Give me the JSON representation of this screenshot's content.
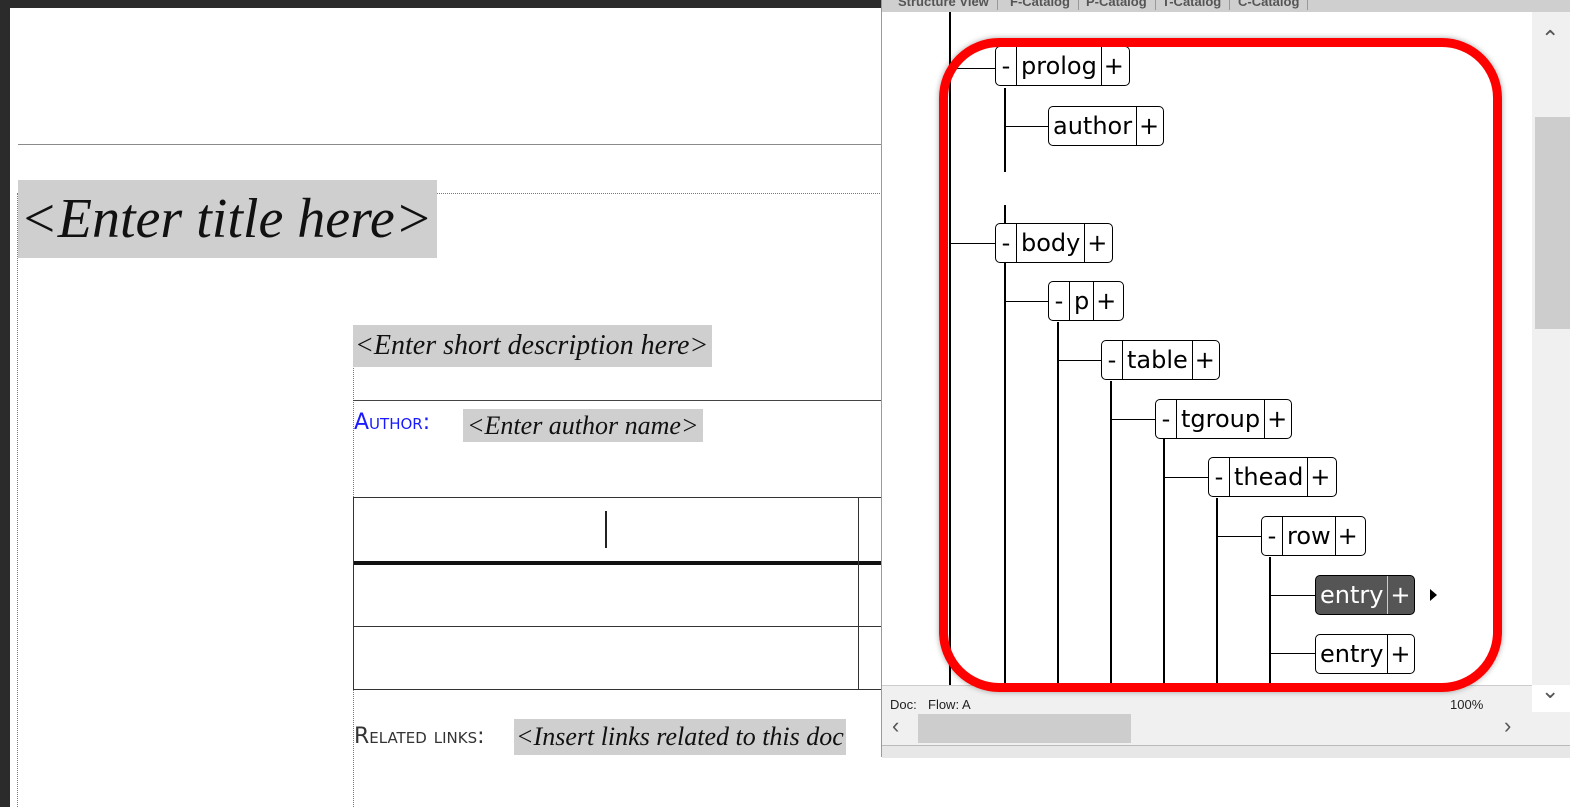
{
  "document": {
    "title_placeholder": "<Enter title here>",
    "shortdesc_placeholder": "<Enter short description here>",
    "author_label": "Author:",
    "author_placeholder": "<Enter author name>",
    "related_links_label": "Related links:",
    "related_links_placeholder": "<Insert links related to this doc"
  },
  "structure_view": {
    "tabs": [
      "Structure View",
      "F-Catalog",
      "P-Catalog",
      "T-Catalog",
      "C-Catalog"
    ],
    "nodes": [
      {
        "label": "prolog",
        "collapse": "-",
        "expand": "+"
      },
      {
        "label": "author",
        "collapse": "",
        "expand": "+"
      },
      {
        "label": "body",
        "collapse": "-",
        "expand": "+"
      },
      {
        "label": "p",
        "collapse": "-",
        "expand": "+"
      },
      {
        "label": "table",
        "collapse": "-",
        "expand": "+"
      },
      {
        "label": "tgroup",
        "collapse": "-",
        "expand": "+"
      },
      {
        "label": "thead",
        "collapse": "-",
        "expand": "+"
      },
      {
        "label": "row",
        "collapse": "-",
        "expand": "+"
      },
      {
        "label": "entry",
        "collapse": "",
        "expand": "+",
        "selected": true
      },
      {
        "label": "entry",
        "collapse": "",
        "expand": "+"
      }
    ],
    "status": {
      "doc": "Doc:",
      "flow": "Flow: A",
      "zoom": "100%"
    }
  },
  "colors": {
    "highlight_box": "#ff0000",
    "placeholder_bg": "#cfcfcf",
    "author_label": "#1a1aff",
    "selected_node": "#555555"
  }
}
